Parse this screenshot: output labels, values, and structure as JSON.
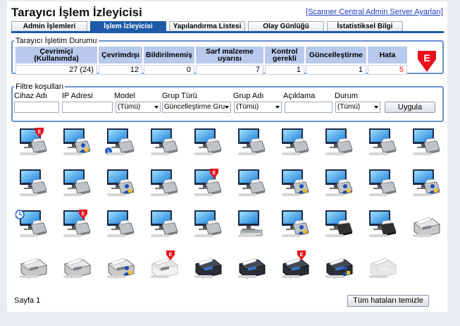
{
  "title": "Tarayıcı İşlem İzleyicisi",
  "admin_link": "[Scanner Central Admin Server Ayarları]",
  "tabs": [
    {
      "label": "Admin İşlemleri",
      "active": false
    },
    {
      "label": "İşlem İzleyicisi",
      "active": true
    },
    {
      "label": "Yapılandırma Listesi",
      "active": false
    },
    {
      "label": "Olay Günlüğü",
      "active": false
    },
    {
      "label": "İstatistiksel Bilgi",
      "active": false
    }
  ],
  "status": {
    "legend": "Tarayıcı İşletim Durumu",
    "headers": [
      "Çevrimiçi (Kullanımda)",
      "Çevrimdışı",
      "Bildirilmemiş",
      "Sarf malzeme uyarısı",
      "Kontrol gerekli",
      "Güncelleştirme",
      "Hata"
    ],
    "values": [
      "27 (24)",
      "12",
      "0",
      "7",
      "1",
      "1",
      "5"
    ],
    "badge_letter": "E",
    "error_color": "#e8111b"
  },
  "filter": {
    "legend": "Filtre koşulları",
    "labels": {
      "device": "Cihaz Adı",
      "ip": "IP Adresi",
      "model": "Model",
      "group_type": "Grup Türü",
      "group_name": "Grup Adı",
      "description": "Açıklama",
      "state": "Durum"
    },
    "values": {
      "device": "",
      "ip": "",
      "model": "(Tümü)",
      "group_type": "Güncelleştirme Gru",
      "group_name": "(Tümü)",
      "description": "",
      "state": "(Tümü)"
    },
    "apply_label": "Uygula"
  },
  "scanners": [
    {
      "kind": "pc",
      "overlay": "error"
    },
    {
      "kind": "pc",
      "overlay": "user"
    },
    {
      "kind": "pc",
      "overlay": "info"
    },
    {
      "kind": "pc",
      "overlay": "none"
    },
    {
      "kind": "pc",
      "overlay": "none"
    },
    {
      "kind": "pc",
      "overlay": "none"
    },
    {
      "kind": "pc",
      "overlay": "none"
    },
    {
      "kind": "pc",
      "overlay": "none"
    },
    {
      "kind": "pc",
      "overlay": "none"
    },
    {
      "kind": "pc",
      "overlay": "none"
    },
    {
      "kind": "pc",
      "overlay": "none"
    },
    {
      "kind": "pc",
      "overlay": "none"
    },
    {
      "kind": "pc",
      "overlay": "user"
    },
    {
      "kind": "pc",
      "overlay": "none"
    },
    {
      "kind": "pc",
      "overlay": "error"
    },
    {
      "kind": "pc",
      "overlay": "none"
    },
    {
      "kind": "pc",
      "overlay": "user"
    },
    {
      "kind": "pc",
      "overlay": "user"
    },
    {
      "kind": "pc",
      "overlay": "none"
    },
    {
      "kind": "pc",
      "overlay": "user"
    },
    {
      "kind": "pc",
      "overlay": "clock"
    },
    {
      "kind": "pc",
      "overlay": "error"
    },
    {
      "kind": "pc",
      "overlay": "none"
    },
    {
      "kind": "pc",
      "overlay": "none"
    },
    {
      "kind": "pc",
      "overlay": "none"
    },
    {
      "kind": "pc-flatbed",
      "overlay": "none"
    },
    {
      "kind": "pc",
      "overlay": "user"
    },
    {
      "kind": "pc-dark",
      "overlay": "none"
    },
    {
      "kind": "pc-dark",
      "overlay": "none"
    },
    {
      "kind": "scanner-gray",
      "overlay": "none"
    },
    {
      "kind": "scanner-gray",
      "overlay": "none"
    },
    {
      "kind": "scanner-gray",
      "overlay": "none"
    },
    {
      "kind": "scanner-gray",
      "overlay": "user"
    },
    {
      "kind": "scanner-white",
      "overlay": "error"
    },
    {
      "kind": "scanner-dark",
      "overlay": "none"
    },
    {
      "kind": "scanner-dark",
      "overlay": "none"
    },
    {
      "kind": "scanner-dark",
      "overlay": "error"
    },
    {
      "kind": "scanner-dark",
      "overlay": "user"
    },
    {
      "kind": "scanner-faded",
      "overlay": "none"
    }
  ],
  "footer": {
    "page_label": "Sayfa 1",
    "clear_button": "Tüm hataları temizle"
  },
  "colors": {
    "accent": "#1e5aa8",
    "header_cell": "#b8c9ec",
    "fieldset_border": "#6e8fd1",
    "link": "#1a39b8"
  }
}
